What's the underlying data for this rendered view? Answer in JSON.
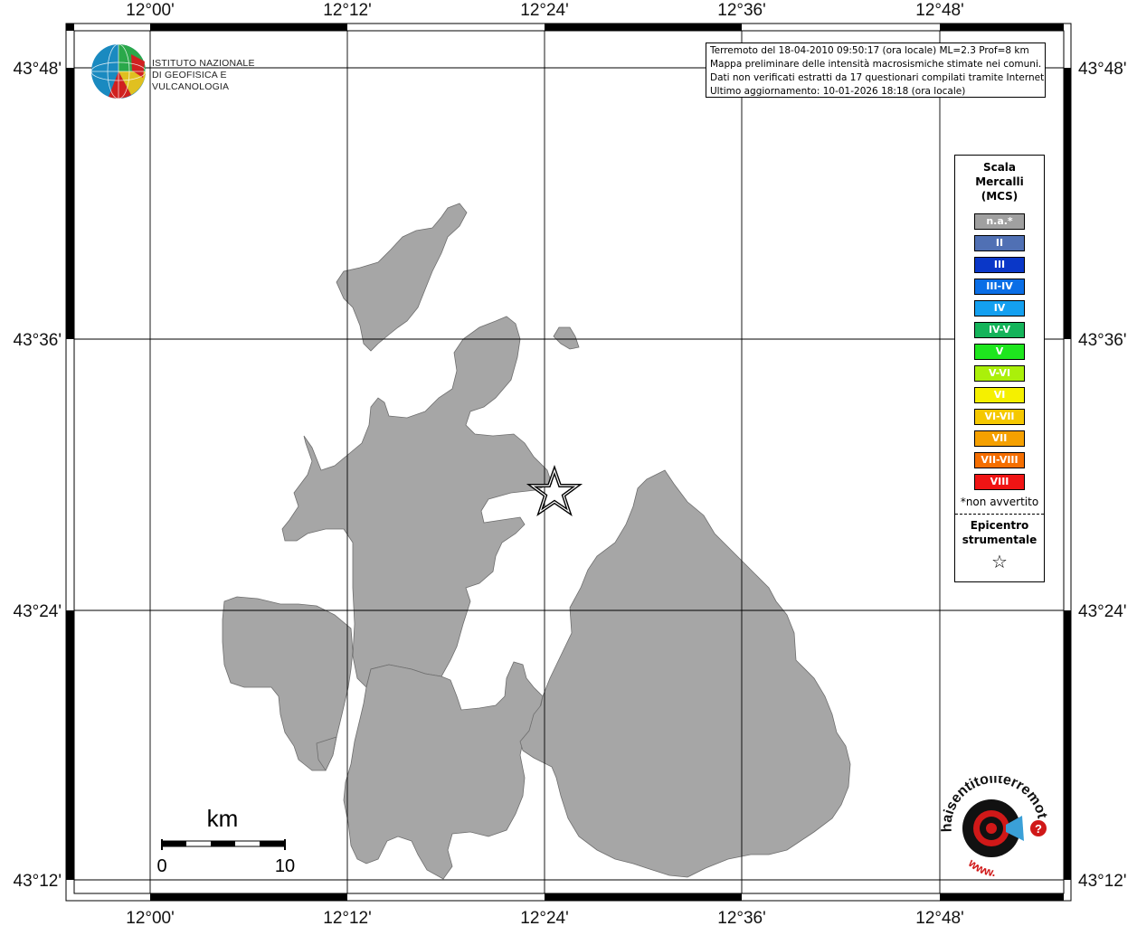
{
  "map": {
    "lon_labels": [
      "12°00'",
      "12°12'",
      "12°24'",
      "12°36'",
      "12°48'"
    ],
    "lat_labels": [
      "43°48'",
      "43°36'",
      "43°24'",
      "43°12'"
    ]
  },
  "info": {
    "line1": "Terremoto del 18-04-2010 09:50:17 (ora locale) ML=2.3 Prof=8 km",
    "line2": "Mappa preliminare delle intensità macrosismiche stimate nei comuni.",
    "line3": "Dati non verificati estratti da 17 questionari compilati tramite Internet.",
    "line4": "Ultimo aggiornamento: 10-01-2026 18:18 (ora locale)"
  },
  "logo": {
    "line1": "ISTITUTO NAZIONALE",
    "line2": "DI GEOFISICA E VULCANOLOGIA"
  },
  "legend": {
    "title1": "Scala",
    "title2": "Mercalli",
    "title3": "(MCS)",
    "items": [
      {
        "label": "n.a.*",
        "color": "#a0a0a0"
      },
      {
        "label": "II",
        "color": "#5070b4"
      },
      {
        "label": "III",
        "color": "#0a37c8"
      },
      {
        "label": "III-IV",
        "color": "#0a6ee6"
      },
      {
        "label": "IV",
        "color": "#14a0f0"
      },
      {
        "label": "IV-V",
        "color": "#14b45a"
      },
      {
        "label": "V",
        "color": "#1ee61e"
      },
      {
        "label": "V-VI",
        "color": "#aaf00a"
      },
      {
        "label": "VI",
        "color": "#f5f000"
      },
      {
        "label": "VI-VII",
        "color": "#f5c800"
      },
      {
        "label": "VII",
        "color": "#f5a000"
      },
      {
        "label": "VII-VIII",
        "color": "#f56e00"
      },
      {
        "label": "VIII",
        "color": "#f01414"
      }
    ],
    "note": "*non avvertito",
    "epicentre1": "Epicentro",
    "epicentre2": "strumentale",
    "star": "☆"
  },
  "scale": {
    "unit": "km",
    "start": "0",
    "end": "10"
  },
  "branding": {
    "site": "haisentitoilterremoto.it",
    "www": "www."
  },
  "colors": {
    "municipality_fill": "#a6a6a6",
    "frame": "#000000"
  }
}
